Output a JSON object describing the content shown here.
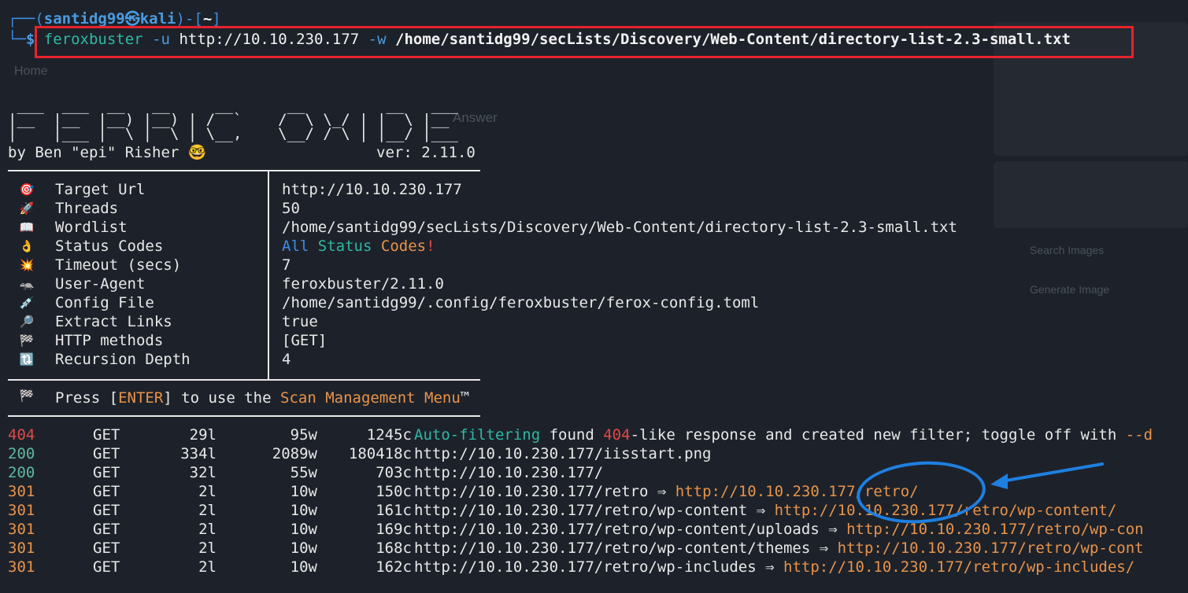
{
  "prompt": {
    "open": "┌──(",
    "user": "santidg99㉿kali",
    "close": ")-[",
    "dir": "~",
    "end": "]",
    "second": "└─",
    "dollar": "$"
  },
  "command": {
    "bin": "feroxbuster",
    "flag_u": "-u",
    "url": "http://10.10.230.177",
    "flag_w": "-w",
    "wordlist": "/home/santidg99/secLists/Discovery/Web-Content/directory-list-2.3-small.txt"
  },
  "banner": {
    "ascii": [
      " ___  ___  __   __     __      __         __   ___",
      "|__  |__  |__) |__) | /  `    /  \\ \\_/ | |  \\ |__",
      "|    |___ |  \\ |  \\ | \\__,    \\__/ / \\ | |__/ |___"
    ],
    "author": "by Ben \"epi\" Risher 🤓",
    "version": "ver: 2.11.0"
  },
  "config": [
    {
      "icon": "🎯",
      "label": "Target Url",
      "value": "http://10.10.230.177"
    },
    {
      "icon": "🚀",
      "label": "Threads",
      "value": "50"
    },
    {
      "icon": "📖",
      "label": "Wordlist",
      "value": "/home/santidg99/secLists/Discovery/Web-Content/directory-list-2.3-small.txt"
    },
    {
      "icon": "👌",
      "label": "Status Codes",
      "value": ""
    },
    {
      "icon": "💥",
      "label": "Timeout (secs)",
      "value": "7"
    },
    {
      "icon": "🦡",
      "label": "User-Agent",
      "value": "feroxbuster/2.11.0"
    },
    {
      "icon": "💉",
      "label": "Config File",
      "value": "/home/santidg99/.config/feroxbuster/ferox-config.toml"
    },
    {
      "icon": "🔎",
      "label": "Extract Links",
      "value": "true"
    },
    {
      "icon": "🏁",
      "label": "HTTP methods",
      "value": "[GET]"
    },
    {
      "icon": "🔃",
      "label": "Recursion Depth",
      "value": "4"
    }
  ],
  "status_codes": {
    "all": "All",
    "status": "Status",
    "codes": "Codes",
    "bang": "!"
  },
  "press": {
    "icon": "🏁",
    "pre": "Press [",
    "key": "ENTER",
    "mid": "] to use the ",
    "menu": "Scan Management Menu",
    "tm": "™"
  },
  "results": [
    {
      "status": "404",
      "method": "GET",
      "lines": "29l",
      "words": "95w",
      "chars": "1245c",
      "url": "",
      "note_a": "Auto-filtering",
      "note_b": " found ",
      "note_c": "404",
      "note_d": "-like response and created new filter; toggle off with ",
      "note_e": "--d",
      "redirect": ""
    },
    {
      "status": "200",
      "method": "GET",
      "lines": "334l",
      "words": "2089w",
      "chars": "180418c",
      "url": "http://10.10.230.177/iisstart.png",
      "redirect": ""
    },
    {
      "status": "200",
      "method": "GET",
      "lines": "32l",
      "words": "55w",
      "chars": "703c",
      "url": "http://10.10.230.177/",
      "redirect": ""
    },
    {
      "status": "301",
      "method": "GET",
      "lines": "2l",
      "words": "10w",
      "chars": "150c",
      "url": "http://10.10.230.177/retro",
      "arrow": " ⇒ ",
      "redirect": "http://10.10.230.177/retro/"
    },
    {
      "status": "301",
      "method": "GET",
      "lines": "2l",
      "words": "10w",
      "chars": "161c",
      "url": "http://10.10.230.177/retro/wp-content",
      "arrow": " ⇒ ",
      "redirect": "http://10.10.230.177/retro/wp-content/"
    },
    {
      "status": "301",
      "method": "GET",
      "lines": "2l",
      "words": "10w",
      "chars": "169c",
      "url": "http://10.10.230.177/retro/wp-content/uploads",
      "arrow": " ⇒ ",
      "redirect": "http://10.10.230.177/retro/wp-con"
    },
    {
      "status": "301",
      "method": "GET",
      "lines": "2l",
      "words": "10w",
      "chars": "168c",
      "url": "http://10.10.230.177/retro/wp-content/themes",
      "arrow": " ⇒ ",
      "redirect": "http://10.10.230.177/retro/wp-cont"
    },
    {
      "status": "301",
      "method": "GET",
      "lines": "2l",
      "words": "10w",
      "chars": "162c",
      "url": "http://10.10.230.177/retro/wp-includes",
      "arrow": " ⇒ ",
      "redirect": "http://10.10.230.177/retro/wp-includes/"
    }
  ],
  "colors": {
    "background": "#1d222a",
    "highlight_box": "#e8232b",
    "annotation": "#1e7fe0",
    "status_404": "#e04848",
    "status_200": "#5fb8a0",
    "status_301": "#e8934a"
  }
}
